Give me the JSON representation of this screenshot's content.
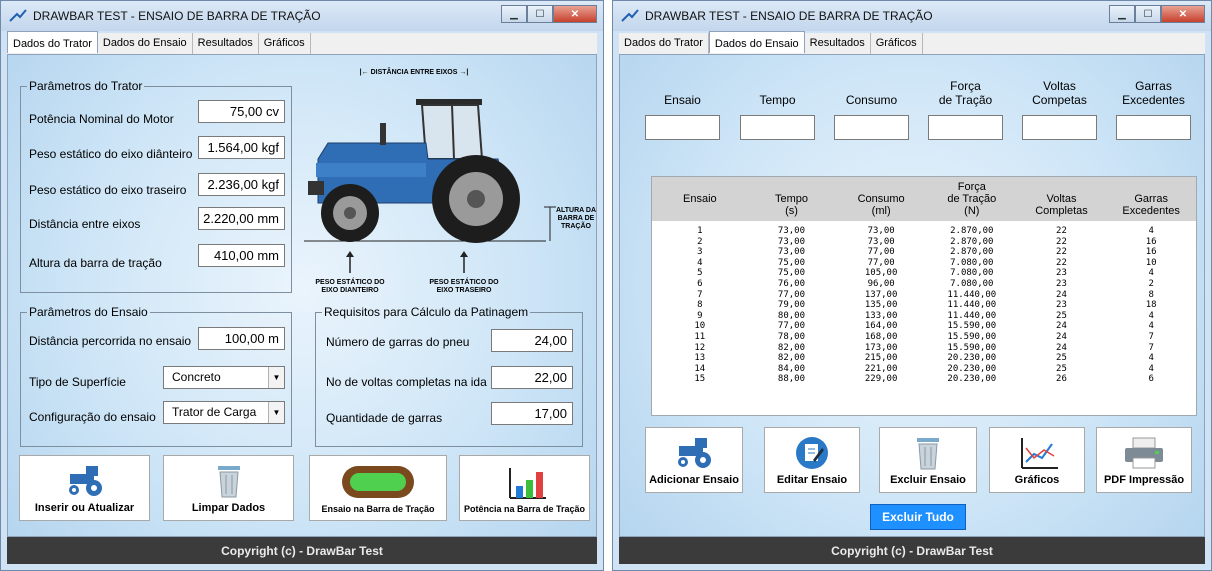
{
  "left_window": {
    "title": "DRAWBAR TEST - ENSAIO DE BARRA DE TRAÇÃO",
    "tabs": [
      "Dados do Trator",
      "Dados do Ensaio",
      "Resultados",
      "Gráficos"
    ],
    "active_tab": "Dados do Trator",
    "tractor_params": {
      "legend": "Parâmetros do Trator",
      "power_label": "Potência Nominal do Motor",
      "power_value": "75,00 cv",
      "front_weight_label": "Peso estático do eixo diânteiro",
      "front_weight_value": "1.564,00 kgf",
      "rear_weight_label": "Peso estático do eixo traseiro",
      "rear_weight_value": "2.236,00 kgf",
      "wheelbase_label": "Distância entre eixos",
      "wheelbase_value": "2.220,00 mm",
      "drawbar_height_label": "Altura da barra de tração",
      "drawbar_height_value": "410,00 mm"
    },
    "diagram": {
      "wheelbase_caption": "DISTÂNCIA ENTRE EIXOS",
      "height_caption_1": "ALTURA DA",
      "height_caption_2": "BARRA DE",
      "height_caption_3": "TRAÇÃO",
      "front_caption_1": "PESO ESTÁTICO DO",
      "front_caption_2": "EIXO DIANTEIRO",
      "rear_caption_1": "PESO ESTÁTICO DO",
      "rear_caption_2": "EIXO TRASEIRO"
    },
    "test_params": {
      "legend": "Parâmetros do Ensaio",
      "distance_label": "Distância percorrida no ensaio",
      "distance_value": "100,00 m",
      "surface_label": "Tipo de Superfície",
      "surface_value": "Concreto",
      "config_label": "Configuração do ensaio",
      "config_value": "Trator de Carga"
    },
    "slip_requirements": {
      "legend": "Requisitos para Cálculo da Patinagem",
      "lugs_label": "Número de garras do pneu",
      "lugs_value": "24,00",
      "turns_label": "No de voltas completas na ida",
      "turns_value": "22,00",
      "qty_label": "Quantidade de garras",
      "qty_value": "17,00"
    },
    "buttons": {
      "insert": "Inserir ou Atualizar",
      "clear": "Limpar Dados",
      "test": "Ensaio na Barra de Tração",
      "power": "Potência na Barra de Tração"
    },
    "footer": "Copyright (c) - DrawBar Test"
  },
  "right_window": {
    "title": "DRAWBAR TEST - ENSAIO DE BARRA DE TRAÇÃO",
    "tabs": [
      "Dados do Trator",
      "Dados do Ensaio",
      "Resultados",
      "Gráficos"
    ],
    "active_tab": "Dados do Ensaio",
    "entry_headers": [
      {
        "l1": "",
        "l2": "Ensaio"
      },
      {
        "l1": "",
        "l2": "Tempo"
      },
      {
        "l1": "",
        "l2": "Consumo"
      },
      {
        "l1": "Força",
        "l2": "de Tração"
      },
      {
        "l1": "Voltas",
        "l2": "Competas"
      },
      {
        "l1": "Garras",
        "l2": "Excedentes"
      }
    ],
    "grid_headers": [
      {
        "l1": "",
        "l2": "Ensaio",
        "l3": ""
      },
      {
        "l1": "",
        "l2": "Tempo",
        "l3": "(s)"
      },
      {
        "l1": "",
        "l2": "Consumo",
        "l3": "(ml)"
      },
      {
        "l1": "Força",
        "l2": "de Tração",
        "l3": "(N)"
      },
      {
        "l1": "",
        "l2": "Voltas",
        "l3": "Completas"
      },
      {
        "l1": "",
        "l2": "Garras",
        "l3": "Excedentes"
      }
    ],
    "rows": [
      [
        "1",
        "73,00",
        "73,00",
        "2.870,00",
        "22",
        "4"
      ],
      [
        "2",
        "73,00",
        "73,00",
        "2.870,00",
        "22",
        "16"
      ],
      [
        "3",
        "73,00",
        "77,00",
        "2.870,00",
        "22",
        "16"
      ],
      [
        "4",
        "75,00",
        "77,00",
        "7.080,00",
        "22",
        "10"
      ],
      [
        "5",
        "75,00",
        "105,00",
        "7.080,00",
        "23",
        "4"
      ],
      [
        "6",
        "76,00",
        "96,00",
        "7.080,00",
        "23",
        "2"
      ],
      [
        "7",
        "77,00",
        "137,00",
        "11.440,00",
        "24",
        "8"
      ],
      [
        "8",
        "79,00",
        "135,00",
        "11.440,00",
        "23",
        "18"
      ],
      [
        "9",
        "80,00",
        "133,00",
        "11.440,00",
        "25",
        "4"
      ],
      [
        "10",
        "77,00",
        "164,00",
        "15.590,00",
        "24",
        "4"
      ],
      [
        "11",
        "78,00",
        "168,00",
        "15.590,00",
        "24",
        "7"
      ],
      [
        "12",
        "82,00",
        "173,00",
        "15.590,00",
        "24",
        "7"
      ],
      [
        "13",
        "82,00",
        "215,00",
        "20.230,00",
        "25",
        "4"
      ],
      [
        "14",
        "84,00",
        "221,00",
        "20.230,00",
        "25",
        "4"
      ],
      [
        "15",
        "88,00",
        "229,00",
        "20.230,00",
        "26",
        "6"
      ]
    ],
    "buttons": {
      "add": "Adicionar Ensaio",
      "edit": "Editar Ensaio",
      "delete": "Excluir Ensaio",
      "charts": "Gráficos",
      "pdf": "PDF Impressão",
      "delete_all": "Excluir Tudo"
    },
    "footer": "Copyright (c) - DrawBar Test"
  },
  "colors": {
    "tractor_blue": "#2f6db5",
    "accent_button": "#1e90ff",
    "footer_bg": "#3b3b3b"
  }
}
